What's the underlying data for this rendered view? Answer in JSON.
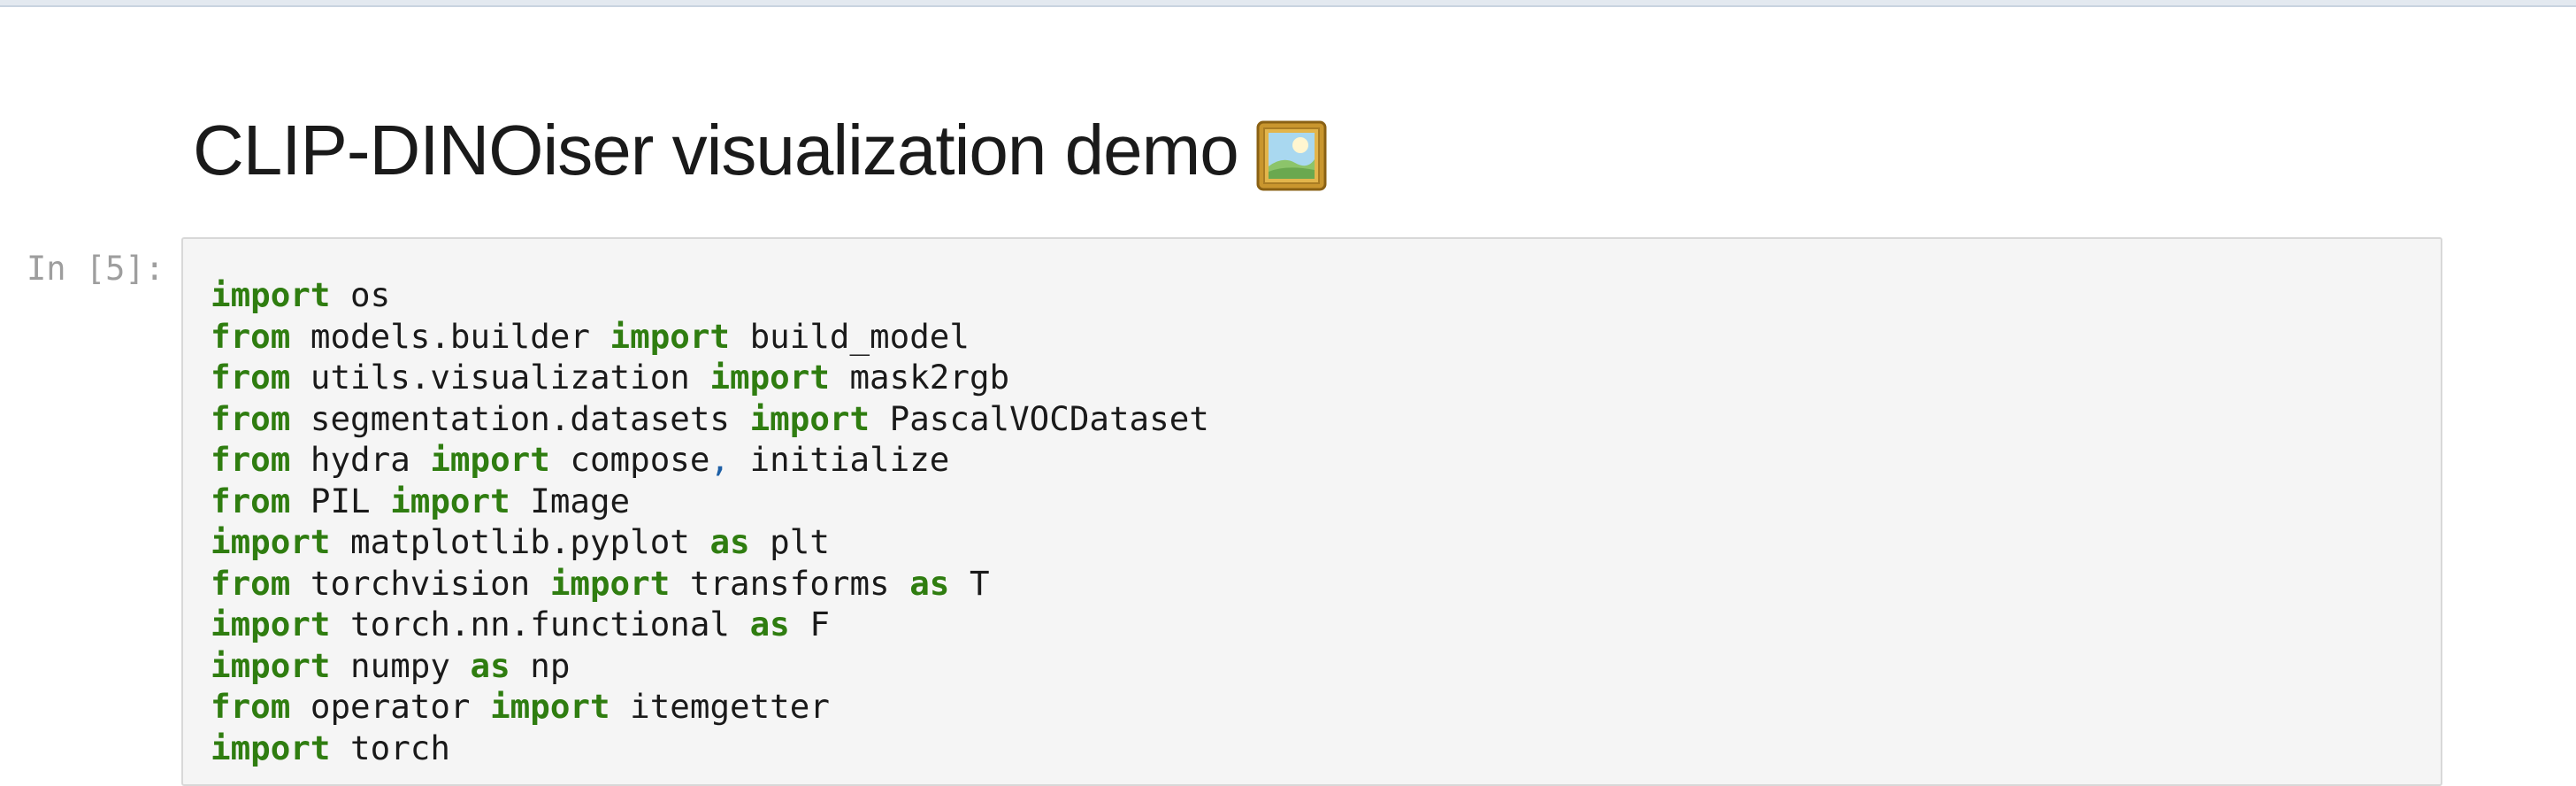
{
  "notebook": {
    "title": "CLIP-DINOiser visualization demo",
    "title_icon": "framed-picture-icon",
    "cells": [
      {
        "prompt": "In [5]:",
        "code_lines": [
          [
            {
              "t": "import",
              "k": "kw"
            },
            {
              "t": " os",
              "k": ""
            }
          ],
          [
            {
              "t": "from",
              "k": "kw"
            },
            {
              "t": " models.builder ",
              "k": ""
            },
            {
              "t": "import",
              "k": "kw"
            },
            {
              "t": " build_model",
              "k": ""
            }
          ],
          [
            {
              "t": "from",
              "k": "kw"
            },
            {
              "t": " utils.visualization ",
              "k": ""
            },
            {
              "t": "import",
              "k": "kw"
            },
            {
              "t": " mask2rgb",
              "k": ""
            }
          ],
          [
            {
              "t": "from",
              "k": "kw"
            },
            {
              "t": " segmentation.datasets ",
              "k": ""
            },
            {
              "t": "import",
              "k": "kw"
            },
            {
              "t": " PascalVOCDataset",
              "k": ""
            }
          ],
          [
            {
              "t": "from",
              "k": "kw"
            },
            {
              "t": " hydra ",
              "k": ""
            },
            {
              "t": "import",
              "k": "kw"
            },
            {
              "t": " compose",
              "k": ""
            },
            {
              "t": ",",
              "k": "op"
            },
            {
              "t": " initialize",
              "k": ""
            }
          ],
          [
            {
              "t": "from",
              "k": "kw"
            },
            {
              "t": " PIL ",
              "k": ""
            },
            {
              "t": "import",
              "k": "kw"
            },
            {
              "t": " Image",
              "k": ""
            }
          ],
          [
            {
              "t": "import",
              "k": "kw"
            },
            {
              "t": " matplotlib.pyplot ",
              "k": ""
            },
            {
              "t": "as",
              "k": "kw"
            },
            {
              "t": " plt",
              "k": ""
            }
          ],
          [
            {
              "t": "from",
              "k": "kw"
            },
            {
              "t": " torchvision ",
              "k": ""
            },
            {
              "t": "import",
              "k": "kw"
            },
            {
              "t": " transforms ",
              "k": ""
            },
            {
              "t": "as",
              "k": "kw"
            },
            {
              "t": " T",
              "k": ""
            }
          ],
          [
            {
              "t": "import",
              "k": "kw"
            },
            {
              "t": " torch.nn.functional ",
              "k": ""
            },
            {
              "t": "as",
              "k": "kw"
            },
            {
              "t": " F",
              "k": ""
            }
          ],
          [
            {
              "t": "import",
              "k": "kw"
            },
            {
              "t": " numpy ",
              "k": ""
            },
            {
              "t": "as",
              "k": "kw"
            },
            {
              "t": " np",
              "k": ""
            }
          ],
          [
            {
              "t": "from",
              "k": "kw"
            },
            {
              "t": " operator ",
              "k": ""
            },
            {
              "t": "import",
              "k": "kw"
            },
            {
              "t": " itemgetter",
              "k": ""
            }
          ],
          [
            {
              "t": "import",
              "k": "kw"
            },
            {
              "t": " torch",
              "k": ""
            }
          ]
        ]
      }
    ]
  },
  "colors": {
    "keyword": "#2f7d10",
    "punctuation": "#1d5fa6",
    "cell_background": "#f5f5f5",
    "prompt": "#9e9e9e"
  }
}
